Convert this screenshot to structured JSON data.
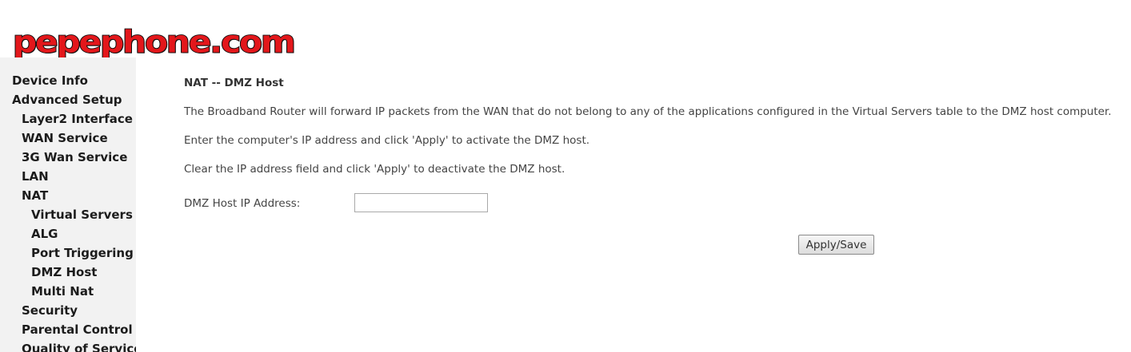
{
  "logo": {
    "text": "pepephone.com",
    "color": "#e3171b"
  },
  "sidebar": {
    "items": [
      {
        "label": "Device Info",
        "level": 0
      },
      {
        "label": "Advanced Setup",
        "level": 0
      },
      {
        "label": "Layer2 Interface",
        "level": 1
      },
      {
        "label": "WAN Service",
        "level": 1
      },
      {
        "label": "3G Wan Service",
        "level": 1
      },
      {
        "label": "LAN",
        "level": 1
      },
      {
        "label": "NAT",
        "level": 1
      },
      {
        "label": "Virtual Servers",
        "level": 2
      },
      {
        "label": "ALG",
        "level": 2
      },
      {
        "label": "Port Triggering",
        "level": 2
      },
      {
        "label": "DMZ Host",
        "level": 2
      },
      {
        "label": "Multi Nat",
        "level": 2
      },
      {
        "label": "Security",
        "level": 1
      },
      {
        "label": "Parental Control",
        "level": 1
      },
      {
        "label": "Quality of Service",
        "level": 1
      }
    ]
  },
  "main": {
    "title": "NAT -- DMZ Host",
    "paragraphs": [
      "The Broadband Router will forward IP packets from the WAN that do not belong to any of the applications configured in the Virtual Servers table to the DMZ host computer.",
      "Enter the computer's IP address and click 'Apply' to activate the DMZ host.",
      "Clear the IP address field and click 'Apply' to deactivate the DMZ host."
    ],
    "field_label": "DMZ Host IP Address:",
    "field_value": "",
    "apply_label": "Apply/Save"
  }
}
